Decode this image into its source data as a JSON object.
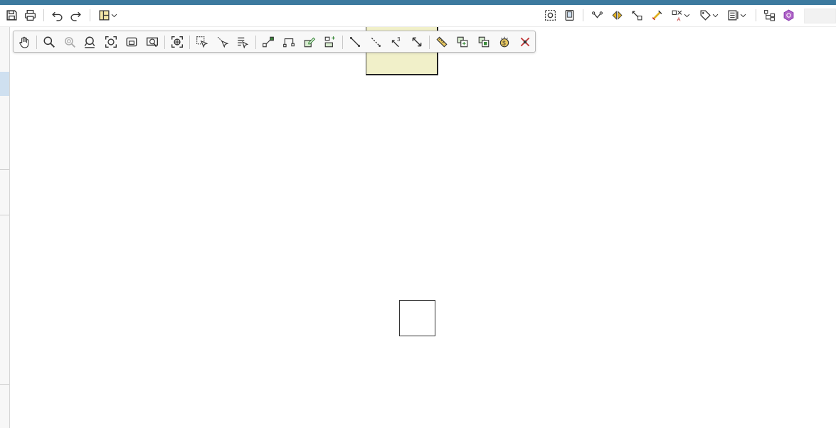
{
  "colors": {
    "title_strip": "#3c7a9f",
    "canvas": "#ffffff",
    "shape_fill": "#f1f0c9",
    "selection_highlight": "#cfe0f0",
    "icon_stroke": "#333333",
    "icon_accent_green": "#3a8a3a",
    "icon_accent_yellow": "#e0b020",
    "icon_accent_red": "#c03030",
    "icon_accent_purple": "#8a3ab0"
  },
  "main_toolbar": {
    "left_icons": [
      "save-icon",
      "print-icon",
      "undo-icon",
      "redo-icon",
      "layout-icon",
      "chevron-down-icon"
    ],
    "right_icons": [
      "snapshot-icon",
      "book-icon",
      "connector-icon",
      "flip-icon",
      "route-icon",
      "tool-icon",
      "style-icon",
      "chevron-down-icon",
      "tag-icon",
      "chevron-down-icon",
      "properties-icon",
      "chevron-down-icon",
      "hierarchy-icon",
      "hexagon-icon"
    ],
    "search_value": ""
  },
  "diagram_toolbar": {
    "icons": [
      "pan-icon",
      "zoom-icon",
      "zoom-actual-icon",
      "zoom-fit-icon",
      "zoom-page-icon",
      "zoom-width-icon",
      "zoom-selection-icon",
      "center-icon",
      "select-icon",
      "select-connectors-icon",
      "select-text-icon",
      "add-node-icon",
      "route-node-icon",
      "edit-node-icon",
      "align-nodes-icon",
      "line-icon",
      "dashed-line-icon",
      "numbered-line-icon",
      "diagonal-icon",
      "ruler-icon",
      "copy-shapes-icon",
      "paste-shapes-icon",
      "settings-icon",
      "delete-icon"
    ]
  }
}
